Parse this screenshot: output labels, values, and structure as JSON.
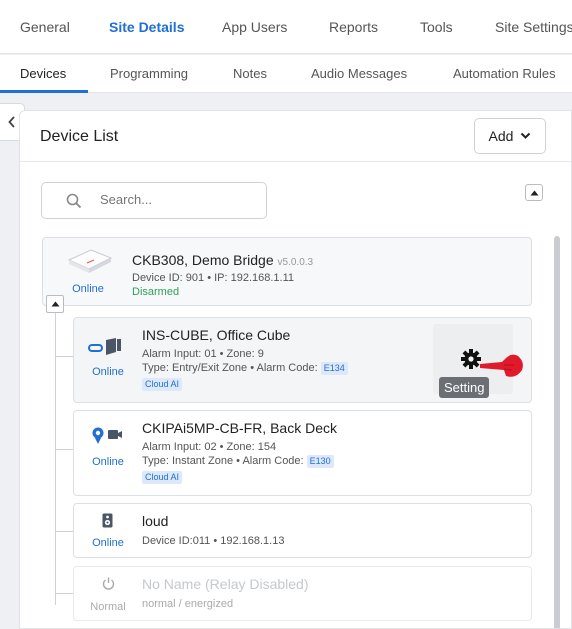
{
  "top_tabs": [
    "General",
    "Site Details",
    "App Users",
    "Reports",
    "Tools",
    "Site Settings"
  ],
  "sub_tabs": [
    "Devices",
    "Programming",
    "Notes",
    "Audio Messages",
    "Automation Rules"
  ],
  "panel": {
    "title": "Device List",
    "add_label": "Add",
    "search_placeholder": "Search..."
  },
  "bridge": {
    "name": "CKB308, Demo Bridge",
    "version": "v5.0.0.3",
    "info": "Device ID: 901 • IP: 192.168.1.11",
    "status": "Online",
    "arm_state": "Disarmed"
  },
  "devices": [
    {
      "name": "INS-CUBE, Office Cube",
      "line1": "Alarm Input: 01 • Zone: 9",
      "line2_prefix": "Type: Entry/Exit Zone • Alarm Code:",
      "code": "E134",
      "tag": "Cloud AI",
      "status": "Online"
    },
    {
      "name": "CKIPAi5MP-CB-FR, Back Deck",
      "line1": "Alarm Input: 02 • Zone: 154",
      "line2_prefix": "Type: Instant Zone • Alarm Code:",
      "code": "E130",
      "tag": "Cloud AI",
      "status": "Online"
    },
    {
      "name": "loud",
      "line1": "Device ID:011 • 192.168.1.13",
      "status": "Online"
    },
    {
      "name": "No Name (Relay Disabled)",
      "line1": "normal / energized",
      "status": "Normal"
    }
  ],
  "tooltip": "Setting",
  "colors": {
    "accent": "#1f6fd6",
    "disarmed": "#2e9e58",
    "pointer": "#e0192b"
  }
}
